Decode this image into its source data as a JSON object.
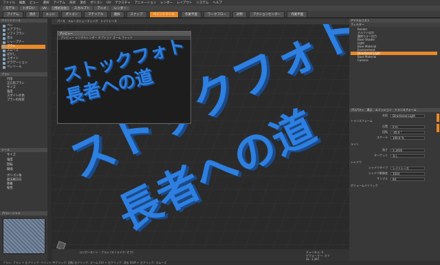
{
  "menubar": [
    "ファイル",
    "編集",
    "ビュー",
    "選択",
    "アイテム",
    "形状",
    "頂点",
    "ポリゴン",
    "UV",
    "テクスチャ",
    "アニメーション",
    "レンダー",
    "レイアウト",
    "システム",
    "ヘルプ"
  ],
  "tabs": [
    "モデル",
    "トポロジ",
    "UV",
    "ペイント",
    "スカルプト",
    "アニメ",
    "レンダー"
  ],
  "active_tab": "ペイント",
  "toolbar": {
    "items": [
      "アイテム",
      "頂点",
      "エッジ",
      "ポリゴン",
      "マテリアル",
      "選択",
      "スナップ",
      "作業平面",
      "スナップ",
      "ワークフロー",
      "対称",
      "ペイントツール",
      "アクションセンター",
      "作業平面"
    ],
    "active": "ペイントツール"
  },
  "left_panel": {
    "tab": "ペイントツール",
    "items": [
      "ペン",
      "エアブラシ",
      "ソフトブラシ",
      "塗る",
      "シャープナー",
      "ブラシ",
      "スムーズ",
      "ぼかし",
      "スポイト",
      "グラデーション",
      "フィル",
      "ペンツール"
    ],
    "selected": "ブラシ",
    "section2": "ブラシ",
    "items2": [
      "円形",
      "正方形ブラシ",
      "サイズ",
      "強度",
      "スポイトの色",
      "ブラシの形状"
    ],
    "section3": "ツール",
    "props": [
      "サイズ",
      "強度",
      "回転",
      "間隔"
    ],
    "checks": [
      "ポリゴン毎",
      "面法線方向",
      "距離",
      "粘性"
    ],
    "preset_label": "プロシージャル"
  },
  "viewport": {
    "headers": [
      "パース",
      "スムーズシェーディング",
      "レイトレース"
    ],
    "main_line1": "ストックフォト",
    "main_line2": "長者への道",
    "status_left": "コンポーネント : ブラシ (ストライク: オフ)",
    "status_right": [
      "チャンネル: 4",
      "デフォーマー: オフ",
      "GL: 1,387"
    ]
  },
  "preview": {
    "title": "プレビュー",
    "toolbar": "プレビュー  シングルレンダー  オプション  ズーム  フィット",
    "line1": "ストックフォト",
    "line2": "長者への道"
  },
  "right_panel": {
    "header": "アイテムリスト",
    "tabs": [
      "アイテム",
      "シェーダーツリー",
      "グループ"
    ],
    "filter_label": "フィルター",
    "items": [
      "Render",
      "アルファ出力",
      "最終カラー出力",
      "Base Shader",
      "Light",
      "Base Material",
      "Environment",
      "Directional Light",
      "Base Material",
      "Camera"
    ],
    "item_values": [
      "",
      "アルファ",
      "最終カラー",
      "フルシェーディング",
      "",
      "",
      "",
      "",
      "",
      "",
      ""
    ],
    "selected_item": "Directional Light",
    "props_tabs": [
      "プロパティ",
      "表示",
      "エミッション",
      "トランスフォーム"
    ],
    "props": {
      "名前": "Directional Light",
      "位置": "0 m",
      "回転": "-45.0 °",
      "強さ": "3.1416",
      "スケール": "100.0 %",
      "ターゲット": "なし",
      "シャドウタイプ": "レイトレース",
      "シャドウ解像度": "1024",
      "サンプル": "64"
    },
    "subsections": [
      "トランスフォーム",
      "ライト",
      "シャドウ",
      "ボリュームメトリック"
    ]
  },
  "bottom": "ブラシ: ブラシ + 左クリック: ペイント  中クリック: 回転  右クリック: ズーム  Ctrl + 左クリック: 消去  Shift + 左クリック: スムーズ",
  "colors": {
    "accent": "#e88a2a",
    "text_blue": "#2d7fe0"
  }
}
